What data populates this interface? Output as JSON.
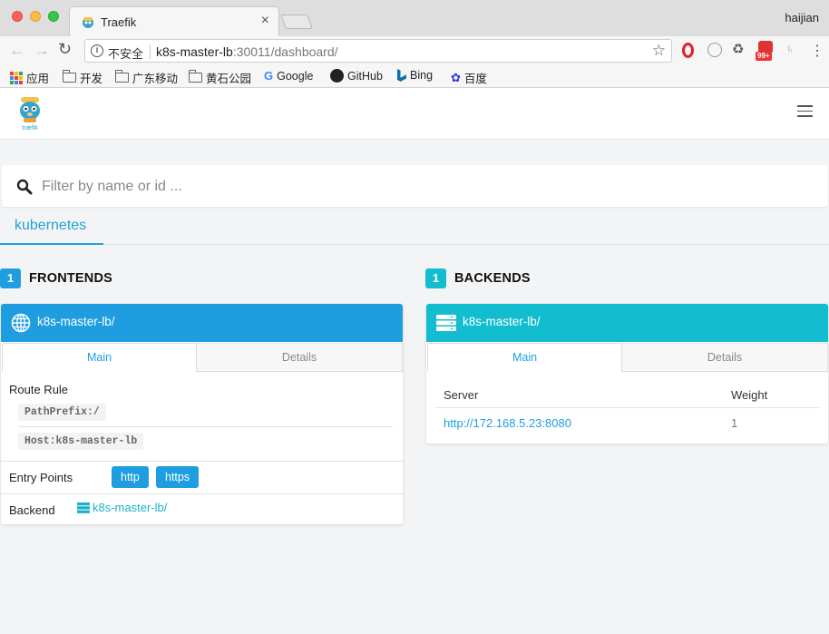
{
  "browser": {
    "tab_title": "Traefik",
    "tab_close": "×",
    "user": "haijian",
    "insecure_label": "不安全",
    "url_host": "k8s-master-lb",
    "url_rest": ":30011/dashboard/",
    "badge": "99+",
    "bookmarks": [
      {
        "label": "应用",
        "icon": "apps-icon"
      },
      {
        "label": "开发",
        "icon": "folder-icon"
      },
      {
        "label": "广东移动",
        "icon": "folder-icon"
      },
      {
        "label": "黄石公园",
        "icon": "folder-icon"
      },
      {
        "label": "Google",
        "icon": "google-icon"
      },
      {
        "label": "GitHub",
        "icon": "github-icon"
      },
      {
        "label": "Bing",
        "icon": "bing-icon"
      },
      {
        "label": "百度",
        "icon": "baidu-icon"
      }
    ]
  },
  "app": {
    "logo_text": "træfik",
    "search_placeholder": "Filter by name or id ...",
    "provider_tab": "kubernetes"
  },
  "frontends": {
    "count": "1",
    "title": "FRONTENDS",
    "accent": "#1e9ee0",
    "card": {
      "name": "k8s-master-lb/",
      "tabs": [
        "Main",
        "Details"
      ],
      "route_rule_label": "Route Rule",
      "route_rules": [
        "PathPrefix:/",
        "Host:k8s-master-lb"
      ],
      "entry_points_label": "Entry Points",
      "entry_points": [
        "http",
        "https"
      ],
      "backend_label": "Backend",
      "backend_value": "k8s-master-lb/"
    }
  },
  "backends": {
    "count": "1",
    "title": "BACKENDS",
    "accent": "#12bdd0",
    "card": {
      "name": "k8s-master-lb/",
      "tabs": [
        "Main",
        "Details"
      ],
      "columns": [
        "Server",
        "Weight"
      ],
      "rows": [
        {
          "server": "http://172.168.5.23:8080",
          "weight": "1"
        }
      ]
    }
  }
}
